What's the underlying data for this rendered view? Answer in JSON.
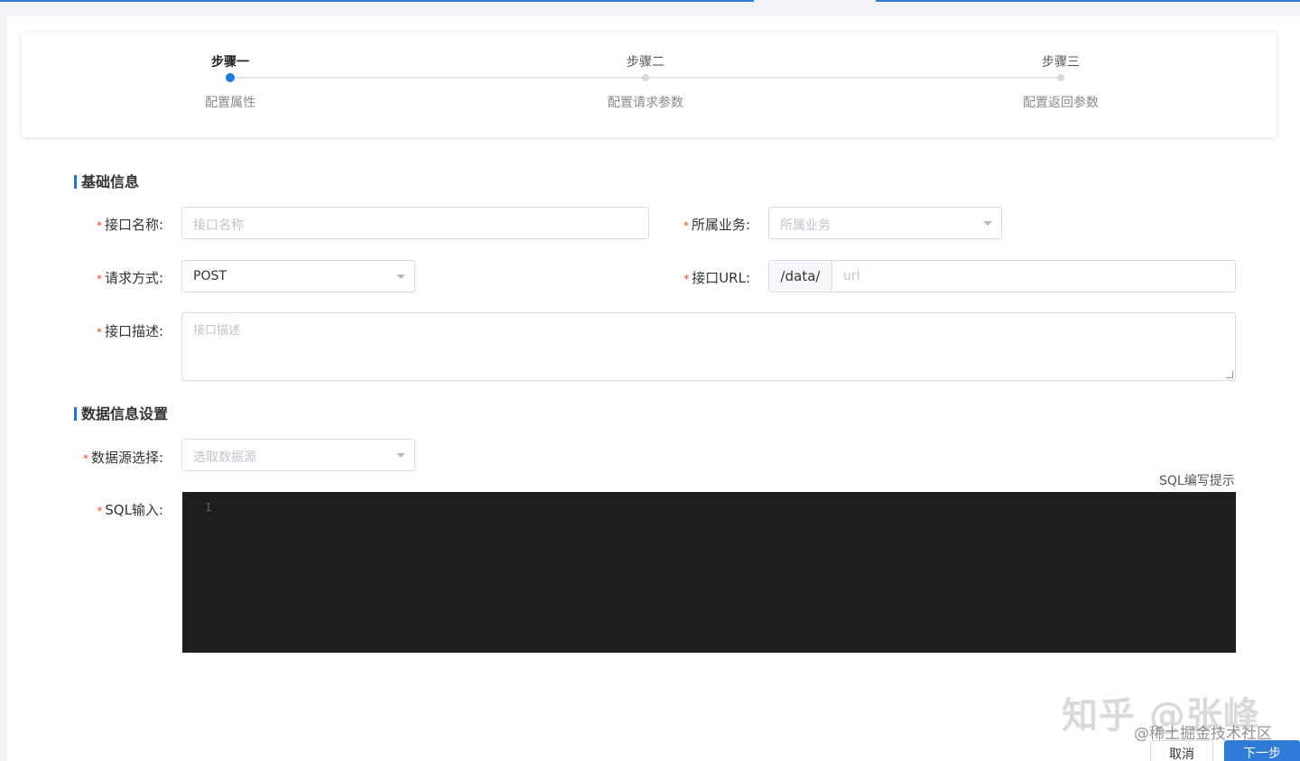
{
  "steps": [
    {
      "title": "步骤一",
      "desc": "配置属性",
      "active": true
    },
    {
      "title": "步骤二",
      "desc": "配置请求参数",
      "active": false
    },
    {
      "title": "步骤三",
      "desc": "配置返回参数",
      "active": false
    }
  ],
  "sections": {
    "basic": "基础信息",
    "data": "数据信息设置"
  },
  "form": {
    "api_name": {
      "label": "接口名称:",
      "placeholder": "接口名称"
    },
    "business": {
      "label": "所属业务:",
      "placeholder": "所属业务"
    },
    "method": {
      "label": "请求方式:",
      "value": "POST"
    },
    "url": {
      "label": "接口URL:",
      "prefix": "/data/",
      "placeholder": "url"
    },
    "desc": {
      "label": "接口描述:",
      "placeholder": "接口描述"
    },
    "datasource": {
      "label": "数据源选择:",
      "placeholder": "选取数据源"
    },
    "sql": {
      "label": "SQL输入:",
      "tip": "SQL编写提示",
      "line_number": "1"
    }
  },
  "required_mark": "*",
  "watermark": {
    "main": "知乎 @张峰",
    "sub": "@稀土掘金技术社区"
  },
  "buttons": {
    "cancel": "取消",
    "next": "下一步"
  },
  "colors": {
    "accent": "#2f7bd8",
    "editor_bg": "#1e1e1e",
    "required": "#e8472f"
  }
}
